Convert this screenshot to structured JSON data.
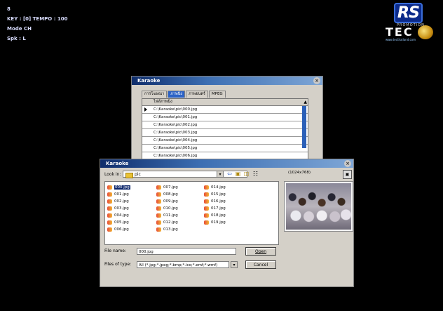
{
  "hud": {
    "line1": "8",
    "line2": "KEY : [0] TEMPO : 100",
    "line3": "Mode CH",
    "line4": "Spk : L"
  },
  "logos": {
    "rs_text": "RS",
    "rs_sub": "PROMOTION",
    "tec_text": "TEC",
    "tec_sub": "www.tecthailand.com"
  },
  "back_window": {
    "title": "Karaoke",
    "tabs": [
      "การโฆษณา",
      "ภาพนิ่ง",
      "ภาพยนตร์",
      "MPEG"
    ],
    "active_tab": 1,
    "column_header": "ไฟล์ภาพนิ่ง",
    "rows": [
      "C:\\Karaoke\\pic\\000.jpg",
      "C:\\Karaoke\\pic\\001.jpg",
      "C:\\Karaoke\\pic\\002.jpg",
      "C:\\Karaoke\\pic\\003.jpg",
      "C:\\Karaoke\\pic\\004.jpg",
      "C:\\Karaoke\\pic\\005.jpg",
      "C:\\Karaoke\\pic\\006.jpg"
    ]
  },
  "open_dialog": {
    "title": "Karaoke",
    "look_in_label": "Look in:",
    "look_in_value": "pic",
    "resolution": "(1024x768)",
    "files_col1": [
      "000.jpg",
      "001.jpg",
      "002.jpg",
      "003.jpg",
      "004.jpg",
      "005.jpg",
      "006.jpg"
    ],
    "files_col2": [
      "007.jpg",
      "008.jpg",
      "009.jpg",
      "010.jpg",
      "011.jpg",
      "012.jpg",
      "013.jpg"
    ],
    "files_col3": [
      "014.jpg",
      "015.jpg",
      "016.jpg",
      "017.jpg",
      "018.jpg",
      "019.jpg"
    ],
    "selected_file": "000.jpg",
    "file_name_label": "File name:",
    "file_name_value": "000.jpg",
    "files_of_type_label": "Files of type:",
    "files_of_type_value": "All (*.jpg;*.jpeg;*.bmp;*.ico;*.emf;*.wmf)",
    "open_label": "Open",
    "cancel_label": "Cancel"
  }
}
